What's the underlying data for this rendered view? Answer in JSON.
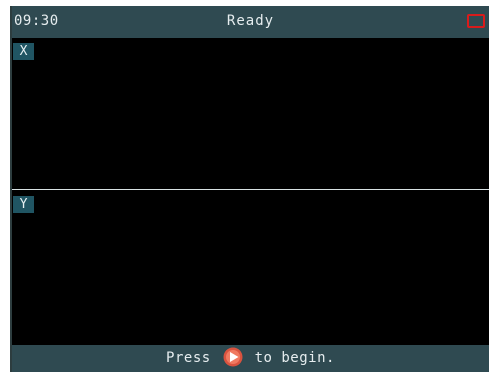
{
  "status_bar": {
    "time": "09:30",
    "status": "Ready",
    "battery_icon": "battery-low-icon",
    "battery_color": "#d91b1b"
  },
  "panels": [
    {
      "label": "X"
    },
    {
      "label": "Y"
    }
  ],
  "footer": {
    "prefix": "Press",
    "icon": "play-icon",
    "suffix": "to begin."
  },
  "colors": {
    "bar_background": "#2f4a51",
    "tag_background": "#205563",
    "screen_background": "#000000",
    "play_icon": "#d9533f"
  }
}
